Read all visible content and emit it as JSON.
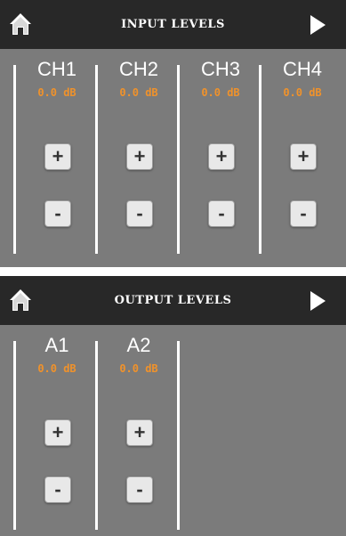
{
  "input": {
    "title": "INPUT LEVELS",
    "channels": [
      {
        "label": "CH1",
        "value": "0.0 dB"
      },
      {
        "label": "CH2",
        "value": "0.0 dB"
      },
      {
        "label": "CH3",
        "value": "0.0 dB"
      },
      {
        "label": "CH4",
        "value": "0.0 dB"
      }
    ]
  },
  "output": {
    "title": "OUTPUT LEVELS",
    "channels": [
      {
        "label": "A1",
        "value": "0.0 dB"
      },
      {
        "label": "A2",
        "value": "0.0 dB"
      }
    ]
  },
  "buttons": {
    "plus": "+",
    "minus": "-"
  },
  "icons": {
    "home": "home-icon",
    "next": "play-right-icon"
  },
  "colors": {
    "header": "#282828",
    "panel": "#7b7b7b",
    "value": "#f0922b",
    "text": "#ffffff"
  }
}
